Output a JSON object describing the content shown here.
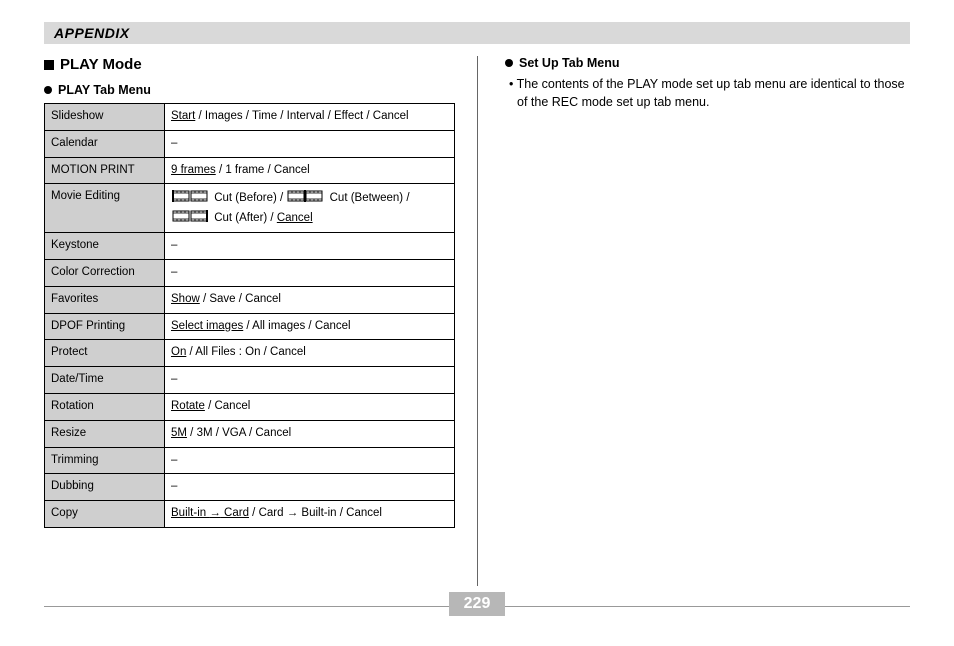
{
  "appendix_label": "APPENDIX",
  "page_number": "229",
  "section_title": "PLAY Mode",
  "left": {
    "subsection": "PLAY Tab Menu",
    "rows": [
      {
        "label": "Slideshow",
        "segments": [
          {
            "t": "Start",
            "u": true
          },
          {
            "t": " / Images / Time / Interval / Effect / Cancel"
          }
        ]
      },
      {
        "label": "Calendar",
        "segments": [
          {
            "t": "–"
          }
        ]
      },
      {
        "label": "MOTION PRINT",
        "segments": [
          {
            "t": "9 frames",
            "u": true
          },
          {
            "t": " / 1 frame / Cancel"
          }
        ]
      },
      {
        "label": "Movie Editing",
        "segments": [
          {
            "film": "cut-before"
          },
          {
            "t": " Cut (Before) / "
          },
          {
            "film": "cut-between"
          },
          {
            "t": " Cut (Between) / "
          },
          {
            "film": "cut-after"
          },
          {
            "t": " Cut (After) / "
          },
          {
            "t": "Cancel",
            "u": true
          }
        ]
      },
      {
        "label": "Keystone",
        "segments": [
          {
            "t": "–"
          }
        ]
      },
      {
        "label": "Color Correction",
        "segments": [
          {
            "t": "–"
          }
        ]
      },
      {
        "label": "Favorites",
        "segments": [
          {
            "t": "Show",
            "u": true
          },
          {
            "t": " / Save / Cancel"
          }
        ]
      },
      {
        "label": "DPOF Printing",
        "segments": [
          {
            "t": "Select images",
            "u": true
          },
          {
            "t": " / All images / Cancel"
          }
        ]
      },
      {
        "label": "Protect",
        "segments": [
          {
            "t": "On",
            "u": true
          },
          {
            "t": " / All Files : On / Cancel"
          }
        ]
      },
      {
        "label": "Date/Time",
        "segments": [
          {
            "t": "–"
          }
        ]
      },
      {
        "label": "Rotation",
        "segments": [
          {
            "t": "Rotate",
            "u": true
          },
          {
            "t": " / Cancel"
          }
        ]
      },
      {
        "label": "Resize",
        "segments": [
          {
            "t": "5M",
            "u": true
          },
          {
            "t": " / 3M / VGA / Cancel"
          }
        ]
      },
      {
        "label": "Trimming",
        "segments": [
          {
            "t": "–"
          }
        ]
      },
      {
        "label": "Dubbing",
        "segments": [
          {
            "t": "–"
          }
        ]
      },
      {
        "label": "Copy",
        "segments": [
          {
            "t": "Built-in ",
            "u": true
          },
          {
            "arrow": true,
            "u": true
          },
          {
            "t": " Card",
            "u": true
          },
          {
            "t": " / Card "
          },
          {
            "arrow": true
          },
          {
            "t": " Built-in / Cancel"
          }
        ]
      }
    ]
  },
  "right": {
    "subsection": "Set Up Tab Menu",
    "body": "The contents of the PLAY mode set up tab menu are identical to those of the REC mode set up tab menu."
  }
}
